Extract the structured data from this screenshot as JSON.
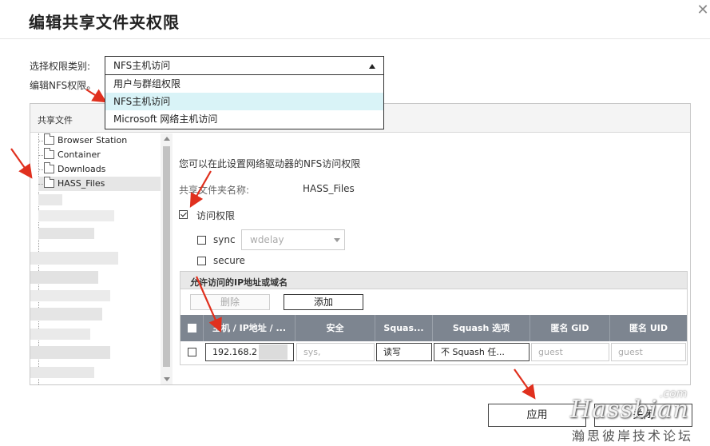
{
  "dialog": {
    "title": "编辑共享文件夹权限",
    "close_glyph": "✕"
  },
  "permission_type": {
    "label": "选择权限类别:",
    "selected": "NFS主机访问",
    "options": [
      "用户与群组权限",
      "NFS主机访问",
      "Microsoft 网络主机访问"
    ],
    "selected_index": 1
  },
  "edit_label": "编辑NFS权限。",
  "panel": {
    "header_label": "共享文件"
  },
  "tree": {
    "items": [
      {
        "label": "Browser Station"
      },
      {
        "label": "Container"
      },
      {
        "label": "Downloads"
      },
      {
        "label": "HASS_Files",
        "selected": true
      }
    ]
  },
  "content": {
    "description": "您可以在此设置网络驱动器的NFS访问权限",
    "share_name_label": "共享文件夹名称:",
    "share_name_value": "HASS_Files",
    "access_right": {
      "label": "访问权限",
      "checked": true
    },
    "sync": {
      "label": "sync",
      "checked": false
    },
    "sync_mode": {
      "value": "wdelay"
    },
    "secure": {
      "label": "secure",
      "checked": false
    }
  },
  "ip_section": {
    "title": "允许访问的IP地址或域名",
    "delete_label": "删除",
    "add_label": "添加",
    "columns": [
      "主机 / IP地址 / ...",
      "安全",
      "Squas...",
      "Squash 选项",
      "匿名 GID",
      "匿名 UID"
    ],
    "rows": [
      {
        "host": "192.168.2",
        "security": "sys,",
        "squash": "读写",
        "squash_option": "不 Squash 任...",
        "anon_gid": "guest",
        "anon_uid": "guest"
      }
    ]
  },
  "footer": {
    "apply_label": "应用",
    "close_label": "关闭"
  },
  "watermark": {
    "brand": "Hassbian",
    "com": ".com",
    "cn": "瀚思彼岸技术论坛"
  },
  "annotation_color": "#e0301e"
}
